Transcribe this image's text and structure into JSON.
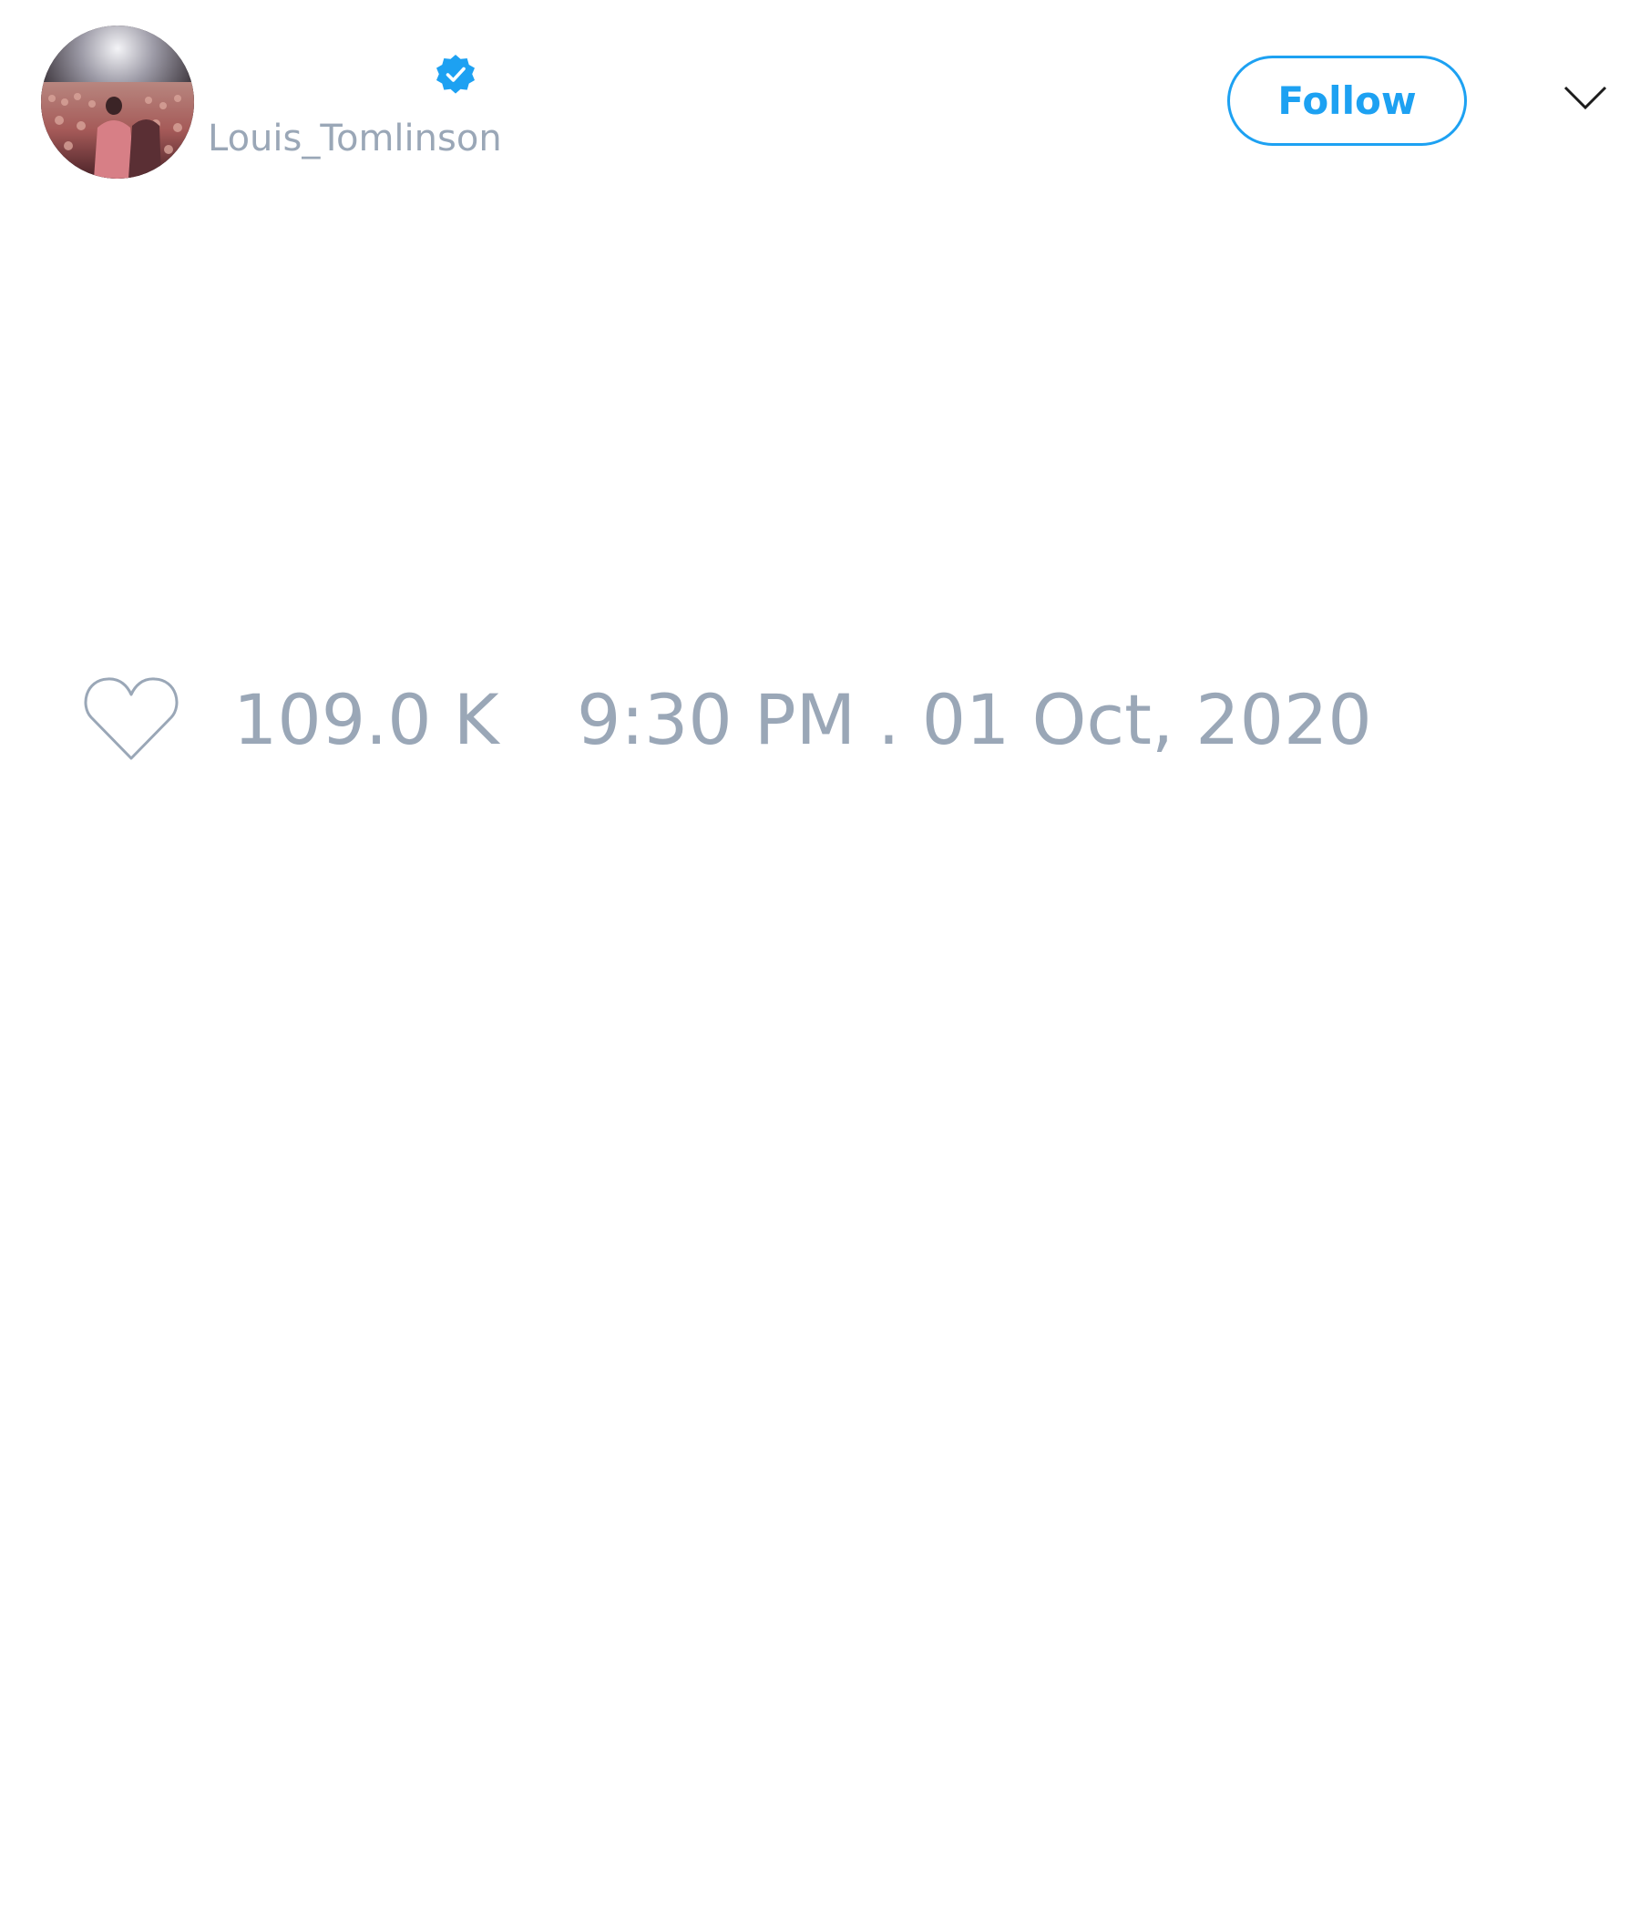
{
  "tweet": {
    "author": {
      "handle": "Louis_Tomlinson",
      "verified": true,
      "avatar": "concert-stage-photo"
    },
    "follow_button": {
      "label": "Follow"
    },
    "menu_icon": "chevron-down-icon",
    "stats": {
      "like_icon": "heart-outline-icon",
      "likes": "109.0 K",
      "timestamp": "9:30 PM . 01 Oct, 2020"
    }
  },
  "colors": {
    "accent": "#1da1f2",
    "muted_text": "#9aa7b7",
    "background": "#ffffff"
  }
}
